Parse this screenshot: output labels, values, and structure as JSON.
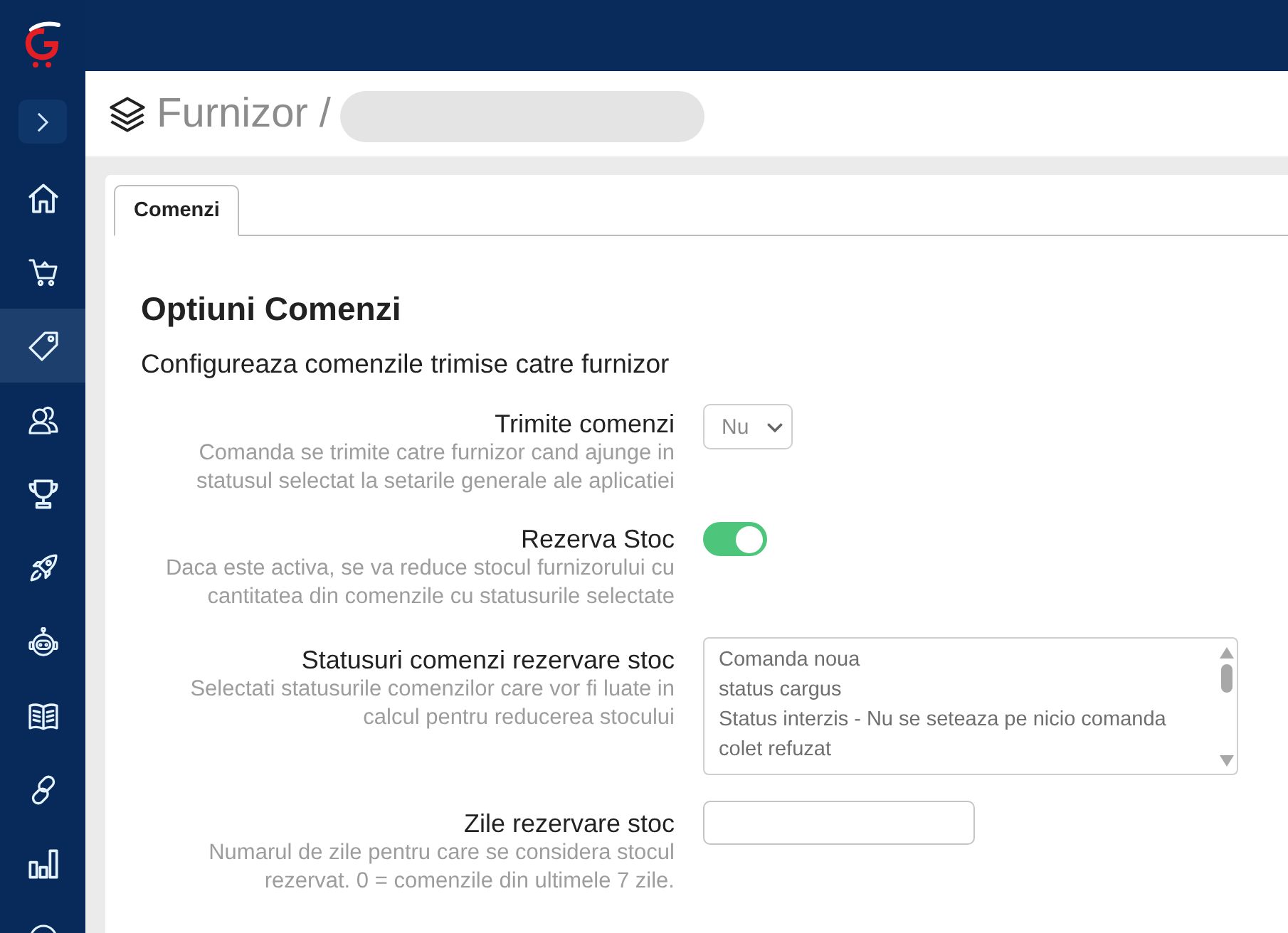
{
  "sidebar": {
    "items": [
      {
        "kind": "home",
        "selected": false
      },
      {
        "kind": "cart",
        "selected": false
      },
      {
        "kind": "tag",
        "selected": true
      },
      {
        "kind": "users",
        "selected": false
      },
      {
        "kind": "trophy",
        "selected": false
      },
      {
        "kind": "rocket",
        "selected": false
      },
      {
        "kind": "robot",
        "selected": false
      },
      {
        "kind": "book",
        "selected": false
      },
      {
        "kind": "link",
        "selected": false
      },
      {
        "kind": "chart",
        "selected": false
      },
      {
        "kind": "partial",
        "selected": false
      }
    ]
  },
  "header": {
    "title": "Furnizor /"
  },
  "tabs": [
    {
      "label": "Comenzi",
      "selected": true
    }
  ],
  "section": {
    "title": "Optiuni Comenzi",
    "subtitle": "Configureaza comenzile trimise catre furnizor"
  },
  "fields": [
    {
      "kind": "select",
      "label": "Trimite comenzi",
      "description": "Comanda se trimite catre furnizor cand ajunge in statusul selectat la setarile generale ale aplicatiei",
      "value": "Nu"
    },
    {
      "kind": "toggle",
      "label": "Rezerva Stoc",
      "description": "Daca este activa, se va reduce stocul furnizorului cu cantitatea din comenzile cu statusurile selectate",
      "on": true
    },
    {
      "kind": "listbox",
      "label": "Statusuri comenzi rezervare stoc",
      "description": "Selectati statusurile comenzilor care vor fi luate in calcul pentru reducerea stocului",
      "options": [
        {
          "label": "Comanda noua",
          "selected": false
        },
        {
          "label": "status cargus",
          "selected": false
        },
        {
          "label": "Status interzis - Nu se seteaza pe nicio comanda",
          "selected": false
        },
        {
          "label": "colet refuzat",
          "selected": false
        }
      ]
    },
    {
      "kind": "text",
      "label": "Zile rezervare stoc",
      "description": "Numarul de zile pentru care se considera stocul rezervat. 0 = comenzile din ultimele 7 zile."
    }
  ]
}
